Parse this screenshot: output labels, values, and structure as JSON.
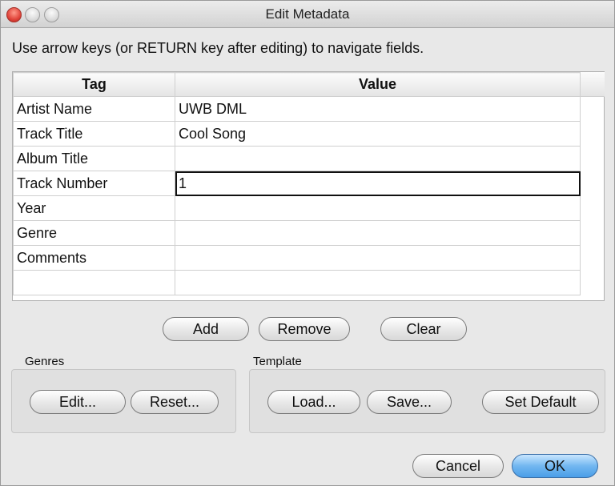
{
  "window": {
    "title": "Edit Metadata"
  },
  "instructions": "Use arrow keys (or RETURN key after editing) to navigate fields.",
  "table": {
    "columns": [
      "Tag",
      "Value"
    ],
    "rows": [
      {
        "tag": "Artist Name",
        "value": "UWB DML"
      },
      {
        "tag": "Track Title",
        "value": "Cool Song"
      },
      {
        "tag": "Album Title",
        "value": ""
      },
      {
        "tag": "Track Number",
        "value": "1"
      },
      {
        "tag": "Year",
        "value": ""
      },
      {
        "tag": "Genre",
        "value": ""
      },
      {
        "tag": "Comments",
        "value": ""
      },
      {
        "tag": "",
        "value": ""
      }
    ]
  },
  "row_actions": {
    "add": "Add",
    "remove": "Remove",
    "clear": "Clear"
  },
  "genres": {
    "label": "Genres",
    "edit": "Edit...",
    "reset": "Reset..."
  },
  "template": {
    "label": "Template",
    "load": "Load...",
    "save": "Save...",
    "set_default": "Set Default"
  },
  "dialog": {
    "cancel": "Cancel",
    "ok": "OK"
  },
  "colors": {
    "ok_accent": "#72b7f0",
    "close_button": "#e0443a"
  }
}
